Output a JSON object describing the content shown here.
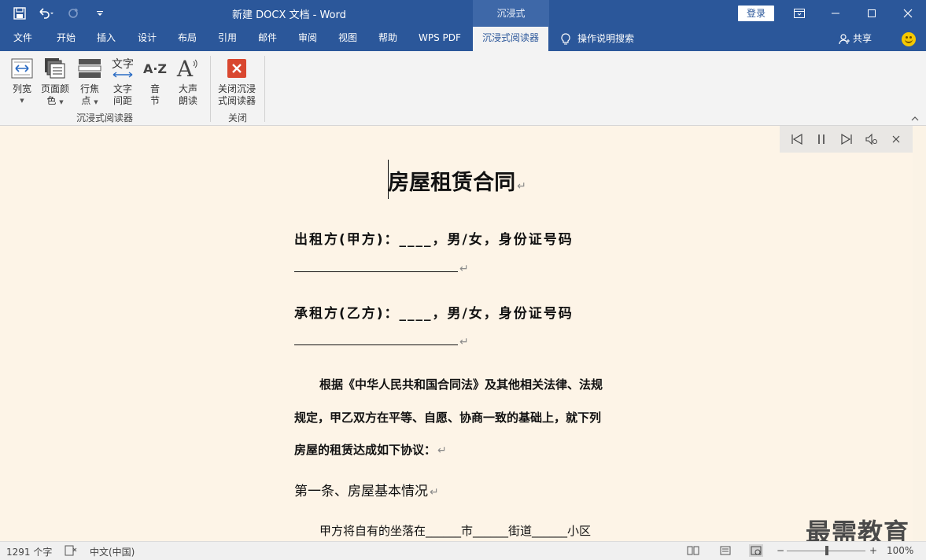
{
  "titlebar": {
    "doc_title": "新建 DOCX 文档  -  Word",
    "context_tab": "沉浸式",
    "login": "登录"
  },
  "tabs": [
    {
      "label": "文件"
    },
    {
      "label": "开始"
    },
    {
      "label": "插入"
    },
    {
      "label": "设计"
    },
    {
      "label": "布局"
    },
    {
      "label": "引用"
    },
    {
      "label": "邮件"
    },
    {
      "label": "审阅"
    },
    {
      "label": "视图"
    },
    {
      "label": "帮助"
    },
    {
      "label": "WPS PDF"
    },
    {
      "label": "沉浸式阅读器"
    }
  ],
  "tellme": "操作说明搜索",
  "share": "共享",
  "ribbon": {
    "buttons": [
      {
        "line1": "列宽",
        "line2": ""
      },
      {
        "line1": "页面颜",
        "line2": "色"
      },
      {
        "line1": "行焦",
        "line2": "点"
      },
      {
        "line1": "文字",
        "line2": "间距"
      },
      {
        "line1": "音",
        "line2": "节"
      },
      {
        "line1": "大声",
        "line2": "朗读"
      },
      {
        "line1": "关闭沉浸",
        "line2": "式阅读器"
      }
    ],
    "group_immersive": "沉浸式阅读器",
    "group_close": "关闭",
    "icon_text_wenzi": "文字",
    "icon_text_az": "A·Z",
    "icon_text_a": "A"
  },
  "document": {
    "title": "房屋租赁合同",
    "party_a": "出租方(甲方)：____，男/女，身份证号码",
    "party_b": "承租方(乙方)：____，男/女，身份证号码",
    "body_line1": "根据《中华人民共和国合同法》及其他相关法律、法规",
    "body_line2": "规定，甲乙双方在平等、自愿、协商一致的基础上，就下列",
    "body_line3": "房屋的租赁达成如下协议：",
    "article1": "第一条、房屋基本情况",
    "article1_body": "甲方将自有的坐落在______市______街道______小区",
    "para_mark": "↵"
  },
  "statusbar": {
    "word_count": "1291 个字",
    "language": "中文(中国)",
    "zoom_minus": "−",
    "zoom_plus": "+",
    "zoom": "100%"
  },
  "watermark": "最需教育"
}
